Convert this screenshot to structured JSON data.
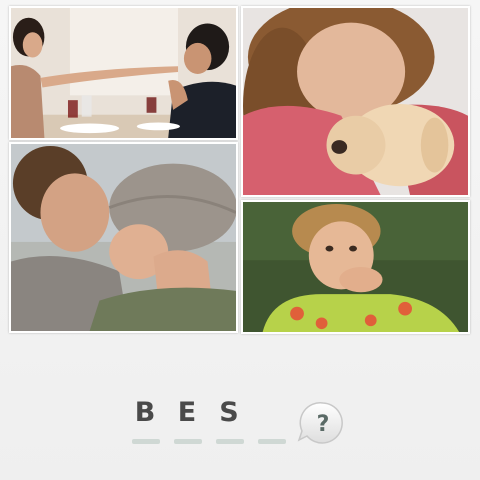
{
  "images": [
    {
      "name": "couple-dinner-photo"
    },
    {
      "name": "girl-with-puppy-photo"
    },
    {
      "name": "couple-forehead-kiss-photo"
    },
    {
      "name": "girl-blowing-kiss-photo"
    }
  ],
  "answer": {
    "slots": [
      "B",
      "E",
      "S",
      ""
    ],
    "slot_color": "#cfd8d4",
    "letter_color": "#4a4a4a"
  },
  "hint_button": {
    "label": "?",
    "icon": "speech-bubble-question-icon"
  }
}
